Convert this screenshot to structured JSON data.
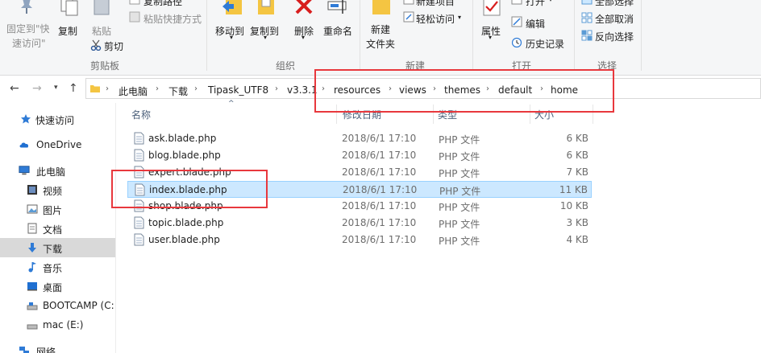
{
  "ribbon": {
    "pin_label_1": "固定到\"快",
    "pin_label_2": "速访问\"",
    "copy": "复制",
    "paste": "粘贴",
    "copy_path": "复制路径",
    "paste_shortcut": "粘贴快捷方式",
    "cut": "剪切",
    "group_clipboard": "剪贴板",
    "move_to": "移动到",
    "copy_to": "复制到",
    "delete": "删除",
    "rename": "重命名",
    "group_organize": "组织",
    "new_folder_1": "新建",
    "new_folder_2": "文件夹",
    "new_item": "新建项目",
    "easy_access": "轻松访问",
    "group_new": "新建",
    "properties": "属性",
    "open": "打开",
    "edit": "编辑",
    "history": "历史记录",
    "group_open": "打开",
    "select_all": "全部选择",
    "select_none": "全部取消",
    "invert_selection": "反向选择",
    "group_select": "选择"
  },
  "breadcrumb": [
    "此电脑",
    "下载",
    "Tipask_UTF8",
    "v3.3.1",
    "resources",
    "views",
    "themes",
    "default",
    "home"
  ],
  "nav": {
    "quick_access": "快速访问",
    "onedrive": "OneDrive",
    "this_pc": "此电脑",
    "videos": "视频",
    "pictures": "图片",
    "documents": "文档",
    "downloads": "下载",
    "music": "音乐",
    "desktop": "桌面",
    "bootcamp": "BOOTCAMP (C:",
    "mac": "mac (E:)",
    "network": "网络"
  },
  "columns": {
    "name": "名称",
    "date": "修改日期",
    "type": "类型",
    "size": "大小"
  },
  "files": [
    {
      "name": "ask.blade.php",
      "date": "2018/6/1 17:10",
      "type": "PHP 文件",
      "size": "6 KB"
    },
    {
      "name": "blog.blade.php",
      "date": "2018/6/1 17:10",
      "type": "PHP 文件",
      "size": "6 KB"
    },
    {
      "name": "expert.blade.php",
      "date": "2018/6/1 17:10",
      "type": "PHP 文件",
      "size": "7 KB"
    },
    {
      "name": "index.blade.php",
      "date": "2018/6/1 17:10",
      "type": "PHP 文件",
      "size": "11 KB"
    },
    {
      "name": "shop.blade.php",
      "date": "2018/6/1 17:10",
      "type": "PHP 文件",
      "size": "10 KB"
    },
    {
      "name": "topic.blade.php",
      "date": "2018/6/1 17:10",
      "type": "PHP 文件",
      "size": "3 KB"
    },
    {
      "name": "user.blade.php",
      "date": "2018/6/1 17:10",
      "type": "PHP 文件",
      "size": "4 KB"
    }
  ],
  "selected_file_index": 3,
  "colors": {
    "highlight": "#e8383d",
    "selection": "#cce8ff",
    "folder": "#f4c542"
  }
}
